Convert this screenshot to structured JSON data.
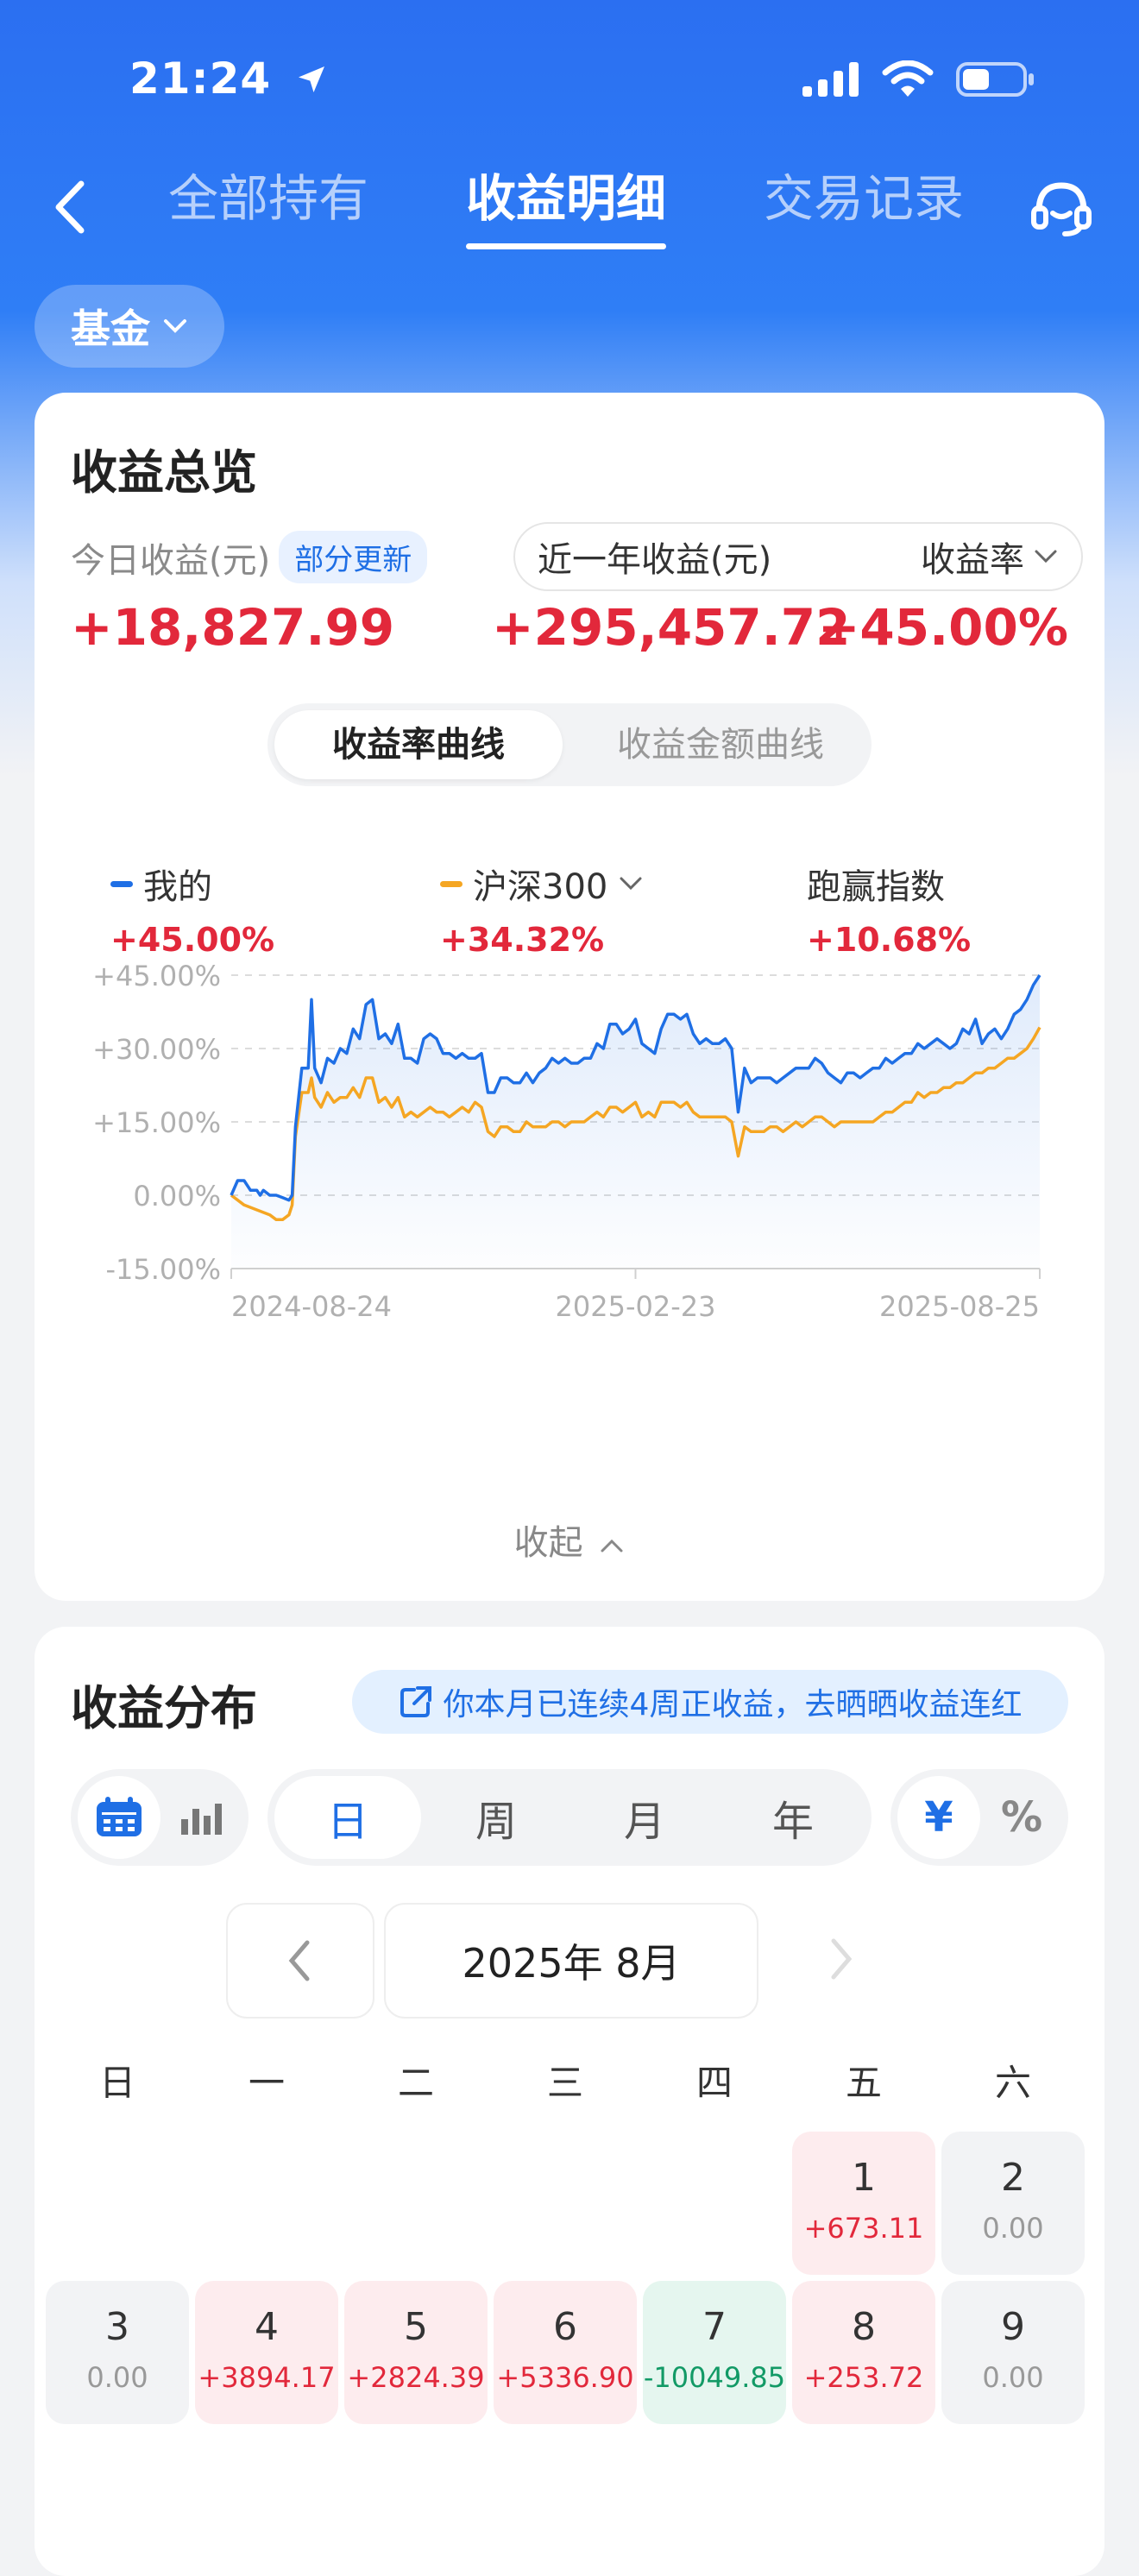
{
  "status": {
    "time": "21:24"
  },
  "nav": {
    "tabs": [
      {
        "label": "全部持有"
      },
      {
        "label": "收益明细"
      },
      {
        "label": "交易记录"
      }
    ]
  },
  "filter": {
    "label": "基金"
  },
  "overview": {
    "title": "收益总览",
    "today_label": "今日收益(元)",
    "update_badge": "部分更新",
    "today_value": "+18,827.99",
    "period_label": "近一年收益(元)",
    "rate_label": "收益率",
    "period_value": "+295,457.72",
    "rate_value": "+45.00%",
    "seg": [
      "收益率曲线",
      "收益金额曲线"
    ],
    "legend": [
      {
        "name": "我的",
        "value": "+45.00%",
        "color": "#1f6fe5"
      },
      {
        "name": "沪深300",
        "value": "+34.32%",
        "color": "#f5a623"
      },
      {
        "name": "跑赢指数",
        "value": "+10.68%"
      }
    ],
    "collapse_label": "收起"
  },
  "chart_data": {
    "type": "line",
    "y_ticks": [
      "+45.00%",
      "+30.00%",
      "+15.00%",
      "0.00%",
      "-15.00%"
    ],
    "x_ticks": [
      "2024-08-24",
      "2025-02-23",
      "2025-08-25"
    ],
    "ylim": [
      -15,
      45
    ],
    "grid": true,
    "series": [
      {
        "name": "我的",
        "color": "#1f6fe5",
        "points": [
          [
            0,
            0
          ],
          [
            2,
            3
          ],
          [
            4,
            3
          ],
          [
            6,
            1
          ],
          [
            8,
            1
          ],
          [
            9,
            0
          ],
          [
            10,
            1
          ],
          [
            12,
            0
          ],
          [
            14,
            0
          ],
          [
            16,
            -0.5
          ],
          [
            18,
            -1
          ],
          [
            19,
            0
          ],
          [
            20,
            14
          ],
          [
            22,
            26
          ],
          [
            24,
            26
          ],
          [
            25,
            40
          ],
          [
            26,
            26
          ],
          [
            28,
            23
          ],
          [
            30,
            28
          ],
          [
            32,
            27
          ],
          [
            34,
            30
          ],
          [
            36,
            29
          ],
          [
            38,
            34
          ],
          [
            40,
            32
          ],
          [
            42,
            39
          ],
          [
            44,
            40
          ],
          [
            46,
            32
          ],
          [
            48,
            33
          ],
          [
            50,
            31
          ],
          [
            52,
            35
          ],
          [
            54,
            28
          ],
          [
            56,
            28
          ],
          [
            58,
            27
          ],
          [
            60,
            32
          ],
          [
            62,
            33
          ],
          [
            64,
            32
          ],
          [
            66,
            29
          ],
          [
            68,
            29
          ],
          [
            70,
            28
          ],
          [
            72,
            29
          ],
          [
            74,
            28
          ],
          [
            76,
            28
          ],
          [
            78,
            29
          ],
          [
            80,
            21
          ],
          [
            82,
            21
          ],
          [
            84,
            24
          ],
          [
            86,
            24
          ],
          [
            88,
            23
          ],
          [
            90,
            23
          ],
          [
            92,
            25
          ],
          [
            94,
            23
          ],
          [
            96,
            25
          ],
          [
            98,
            26
          ],
          [
            100,
            28
          ],
          [
            102,
            27
          ],
          [
            104,
            28
          ],
          [
            106,
            27
          ],
          [
            108,
            27
          ],
          [
            110,
            28
          ],
          [
            112,
            28
          ],
          [
            114,
            31
          ],
          [
            116,
            30
          ],
          [
            118,
            35
          ],
          [
            120,
            35
          ],
          [
            122,
            33
          ],
          [
            124,
            34
          ],
          [
            126,
            36
          ],
          [
            128,
            31
          ],
          [
            130,
            30
          ],
          [
            132,
            29
          ],
          [
            134,
            34
          ],
          [
            136,
            37
          ],
          [
            138,
            37
          ],
          [
            140,
            36
          ],
          [
            142,
            37
          ],
          [
            144,
            33
          ],
          [
            146,
            31
          ],
          [
            148,
            32
          ],
          [
            150,
            31
          ],
          [
            152,
            31
          ],
          [
            154,
            32
          ],
          [
            156,
            30
          ],
          [
            158,
            17
          ],
          [
            160,
            26
          ],
          [
            162,
            23
          ],
          [
            164,
            24
          ],
          [
            166,
            24
          ],
          [
            168,
            24
          ],
          [
            170,
            23
          ],
          [
            172,
            24
          ],
          [
            174,
            25
          ],
          [
            176,
            26
          ],
          [
            178,
            26
          ],
          [
            180,
            26
          ],
          [
            182,
            28
          ],
          [
            184,
            27
          ],
          [
            186,
            25
          ],
          [
            188,
            24
          ],
          [
            190,
            23
          ],
          [
            192,
            25
          ],
          [
            194,
            25
          ],
          [
            196,
            24
          ],
          [
            198,
            25
          ],
          [
            200,
            26
          ],
          [
            202,
            26
          ],
          [
            204,
            28
          ],
          [
            206,
            27
          ],
          [
            208,
            28
          ],
          [
            210,
            29
          ],
          [
            212,
            29
          ],
          [
            214,
            31
          ],
          [
            216,
            30
          ],
          [
            218,
            31
          ],
          [
            220,
            32
          ],
          [
            222,
            31
          ],
          [
            224,
            30
          ],
          [
            226,
            31
          ],
          [
            228,
            34
          ],
          [
            230,
            33
          ],
          [
            232,
            36
          ],
          [
            234,
            31
          ],
          [
            236,
            33
          ],
          [
            238,
            34
          ],
          [
            240,
            32
          ],
          [
            242,
            34
          ],
          [
            244,
            37
          ],
          [
            246,
            38
          ],
          [
            248,
            40
          ],
          [
            250,
            43
          ],
          [
            252,
            45
          ]
        ]
      },
      {
        "name": "沪深300",
        "color": "#f5a623",
        "points": [
          [
            0,
            0
          ],
          [
            4,
            -2
          ],
          [
            8,
            -3
          ],
          [
            12,
            -4
          ],
          [
            14,
            -5
          ],
          [
            16,
            -5
          ],
          [
            18,
            -4
          ],
          [
            19,
            -2
          ],
          [
            20,
            12
          ],
          [
            22,
            21
          ],
          [
            24,
            21
          ],
          [
            25,
            24
          ],
          [
            26,
            20
          ],
          [
            28,
            18
          ],
          [
            30,
            21
          ],
          [
            32,
            19
          ],
          [
            34,
            20
          ],
          [
            36,
            20
          ],
          [
            38,
            22
          ],
          [
            40,
            20
          ],
          [
            42,
            24
          ],
          [
            44,
            24
          ],
          [
            46,
            19
          ],
          [
            48,
            20
          ],
          [
            50,
            18
          ],
          [
            52,
            20
          ],
          [
            54,
            16
          ],
          [
            56,
            17
          ],
          [
            58,
            16
          ],
          [
            60,
            17
          ],
          [
            62,
            18
          ],
          [
            64,
            17
          ],
          [
            66,
            17
          ],
          [
            68,
            16
          ],
          [
            70,
            17
          ],
          [
            72,
            18
          ],
          [
            74,
            17
          ],
          [
            76,
            19
          ],
          [
            78,
            18
          ],
          [
            80,
            13
          ],
          [
            82,
            12
          ],
          [
            84,
            14
          ],
          [
            86,
            14
          ],
          [
            88,
            13
          ],
          [
            90,
            13
          ],
          [
            92,
            15
          ],
          [
            94,
            14
          ],
          [
            96,
            14
          ],
          [
            98,
            14
          ],
          [
            100,
            15
          ],
          [
            102,
            15
          ],
          [
            104,
            14
          ],
          [
            106,
            15
          ],
          [
            108,
            15
          ],
          [
            110,
            15
          ],
          [
            112,
            16
          ],
          [
            114,
            17
          ],
          [
            116,
            16
          ],
          [
            118,
            18
          ],
          [
            120,
            18
          ],
          [
            122,
            17
          ],
          [
            124,
            18
          ],
          [
            126,
            19
          ],
          [
            128,
            16
          ],
          [
            130,
            17
          ],
          [
            132,
            16
          ],
          [
            134,
            19
          ],
          [
            136,
            19
          ],
          [
            138,
            19
          ],
          [
            140,
            18
          ],
          [
            142,
            19
          ],
          [
            144,
            17
          ],
          [
            146,
            16
          ],
          [
            148,
            16
          ],
          [
            150,
            16
          ],
          [
            152,
            16
          ],
          [
            154,
            16
          ],
          [
            156,
            15
          ],
          [
            158,
            8
          ],
          [
            160,
            14
          ],
          [
            162,
            13
          ],
          [
            164,
            13
          ],
          [
            166,
            13
          ],
          [
            168,
            14
          ],
          [
            170,
            14
          ],
          [
            172,
            13
          ],
          [
            174,
            14
          ],
          [
            176,
            15
          ],
          [
            178,
            14
          ],
          [
            180,
            15
          ],
          [
            182,
            16
          ],
          [
            184,
            16
          ],
          [
            186,
            15
          ],
          [
            188,
            14
          ],
          [
            190,
            15
          ],
          [
            192,
            15
          ],
          [
            194,
            15
          ],
          [
            196,
            15
          ],
          [
            198,
            15
          ],
          [
            200,
            15
          ],
          [
            202,
            16
          ],
          [
            204,
            17
          ],
          [
            206,
            17
          ],
          [
            208,
            18
          ],
          [
            210,
            19
          ],
          [
            212,
            19
          ],
          [
            214,
            21
          ],
          [
            216,
            20
          ],
          [
            218,
            21
          ],
          [
            220,
            21
          ],
          [
            222,
            22
          ],
          [
            224,
            22
          ],
          [
            226,
            23
          ],
          [
            228,
            23
          ],
          [
            230,
            24
          ],
          [
            232,
            25
          ],
          [
            234,
            25
          ],
          [
            236,
            26
          ],
          [
            238,
            26
          ],
          [
            240,
            27
          ],
          [
            242,
            28
          ],
          [
            244,
            28
          ],
          [
            246,
            29
          ],
          [
            248,
            30
          ],
          [
            250,
            32
          ],
          [
            252,
            34.32
          ]
        ]
      }
    ]
  },
  "distribution": {
    "title": "收益分布",
    "streak_text": "你本月已连续4周正收益，去晒晒收益连红",
    "periods": [
      "日",
      "周",
      "月",
      "年"
    ],
    "unit_symbols": [
      "¥",
      "%"
    ],
    "month": "2025年 8月",
    "weekdays": [
      "日",
      "一",
      "二",
      "三",
      "四",
      "五",
      "六"
    ],
    "days": [
      {
        "day": "1",
        "value": "+673.11",
        "kind": "pos",
        "col": 5,
        "row": 0
      },
      {
        "day": "2",
        "value": "0.00",
        "kind": "zero",
        "col": 6,
        "row": 0
      },
      {
        "day": "3",
        "value": "0.00",
        "kind": "zero",
        "col": 0,
        "row": 1
      },
      {
        "day": "4",
        "value": "+3894.17",
        "kind": "pos",
        "col": 1,
        "row": 1
      },
      {
        "day": "5",
        "value": "+2824.39",
        "kind": "pos",
        "col": 2,
        "row": 1
      },
      {
        "day": "6",
        "value": "+5336.90",
        "kind": "pos",
        "col": 3,
        "row": 1
      },
      {
        "day": "7",
        "value": "-10049.85",
        "kind": "neg",
        "col": 4,
        "row": 1
      },
      {
        "day": "8",
        "value": "+253.72",
        "kind": "pos",
        "col": 5,
        "row": 1
      },
      {
        "day": "9",
        "value": "0.00",
        "kind": "zero",
        "col": 6,
        "row": 1
      }
    ]
  }
}
